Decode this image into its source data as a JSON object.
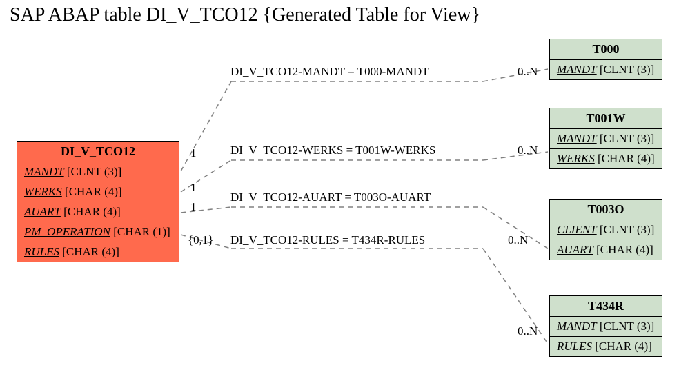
{
  "title": "SAP ABAP table DI_V_TCO12 {Generated Table for View}",
  "main_entity": {
    "name": "DI_V_TCO12",
    "fields": [
      {
        "name": "MANDT",
        "type": "[CLNT (3)]"
      },
      {
        "name": "WERKS",
        "type": "[CHAR (4)]"
      },
      {
        "name": "AUART",
        "type": "[CHAR (4)]"
      },
      {
        "name": "PM_OPERATION",
        "type": "[CHAR (1)]"
      },
      {
        "name": "RULES",
        "type": "[CHAR (4)]"
      }
    ]
  },
  "related_entities": {
    "t000": {
      "name": "T000",
      "fields": [
        {
          "name": "MANDT",
          "type": "[CLNT (3)]"
        }
      ]
    },
    "t001w": {
      "name": "T001W",
      "fields": [
        {
          "name": "MANDT",
          "type": "[CLNT (3)]"
        },
        {
          "name": "WERKS",
          "type": "[CHAR (4)]"
        }
      ]
    },
    "t003o": {
      "name": "T003O",
      "fields": [
        {
          "name": "CLIENT",
          "type": "[CLNT (3)]"
        },
        {
          "name": "AUART",
          "type": "[CHAR (4)]"
        }
      ]
    },
    "t434r": {
      "name": "T434R",
      "fields": [
        {
          "name": "MANDT",
          "type": "[CLNT (3)]"
        },
        {
          "name": "RULES",
          "type": "[CHAR (4)]"
        }
      ]
    }
  },
  "relations": {
    "r1": {
      "label": "DI_V_TCO12-MANDT = T000-MANDT",
      "left_card": "1",
      "right_card": "0..N"
    },
    "r2": {
      "label": "DI_V_TCO12-WERKS = T001W-WERKS",
      "left_card": "1",
      "right_card": "0..N"
    },
    "r3": {
      "label": "DI_V_TCO12-AUART = T003O-AUART",
      "left_card": "1",
      "right_card": "0..N"
    },
    "r4": {
      "label": "DI_V_TCO12-RULES = T434R-RULES",
      "left_card": "{0,1}",
      "right_card": "0..N"
    }
  }
}
